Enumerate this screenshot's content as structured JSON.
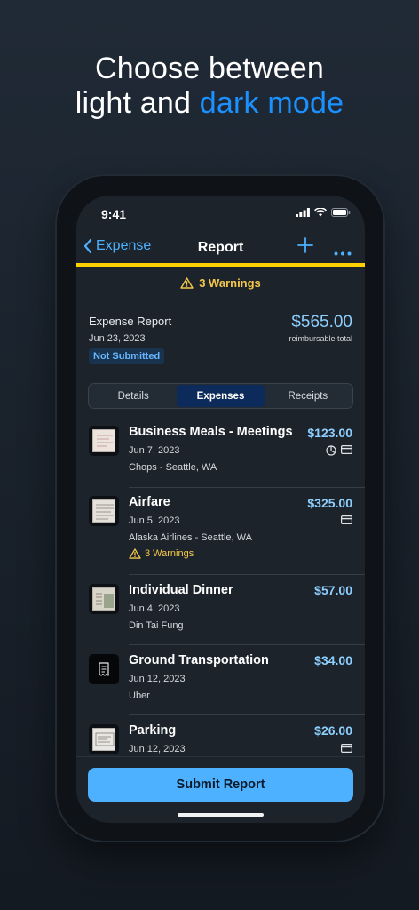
{
  "headline": {
    "line1": "Choose between",
    "line2_plain": "light and ",
    "line2_accent": "dark mode"
  },
  "status": {
    "time": "9:41"
  },
  "nav": {
    "back_label": "Expense",
    "title": "Report"
  },
  "warnings_banner": {
    "text": "3 Warnings"
  },
  "report": {
    "title": "Expense Report",
    "date": "Jun 23, 2023",
    "status": "Not Submitted",
    "amount": "$565.00",
    "amount_caption": "reimbursable total"
  },
  "tabs": [
    {
      "label": "Details",
      "active": false
    },
    {
      "label": "Expenses",
      "active": true
    },
    {
      "label": "Receipts",
      "active": false
    }
  ],
  "expenses": [
    {
      "title": "Business Meals - Meetings",
      "date": "Jun 7, 2023",
      "merchant": "Chops - Seattle, WA",
      "amount": "$123.00",
      "icons": [
        "pie-chart-icon",
        "credit-card-icon"
      ],
      "warning": ""
    },
    {
      "title": "Airfare",
      "date": "Jun 5, 2023",
      "merchant": "Alaska Airlines - Seattle, WA",
      "amount": "$325.00",
      "icons": [
        "credit-card-icon"
      ],
      "warning": "3 Warnings"
    },
    {
      "title": "Individual Dinner",
      "date": "Jun 4, 2023",
      "merchant": "Din Tai Fung",
      "amount": "$57.00",
      "icons": [],
      "warning": ""
    },
    {
      "title": "Ground Transportation",
      "date": "Jun 12, 2023",
      "merchant": "Uber",
      "amount": "$34.00",
      "icons": [],
      "warning": ""
    },
    {
      "title": "Parking",
      "date": "Jun 12, 2023",
      "merchant": "",
      "amount": "$26.00",
      "icons": [
        "credit-card-icon"
      ],
      "warning": ""
    }
  ],
  "submit": {
    "label": "Submit Report"
  },
  "colors": {
    "accent": "#1b90ff",
    "amount": "#8dcfff",
    "warning": "#f4c84a",
    "nav_underline": "#ffd100",
    "button": "#4db1ff"
  }
}
